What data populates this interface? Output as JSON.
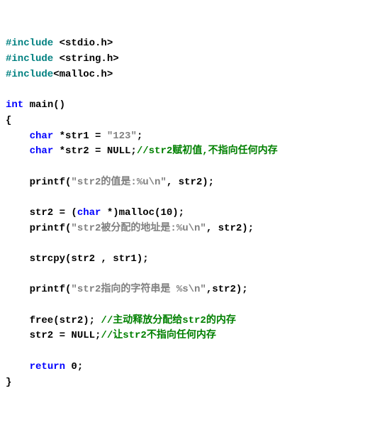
{
  "code": {
    "inc1_a": "#include",
    "inc1_b": " <stdio.h>",
    "inc2_a": "#include",
    "inc2_b": " <string.h>",
    "inc3_a": "#include",
    "inc3_b": "<malloc.h>",
    "int": "int",
    "main": " main()",
    "lbrace": "{",
    "char1_kw": "char",
    "char1_rest": " *str1 = ",
    "char1_str": "\"123\"",
    "char1_semi": ";",
    "char2_kw": "char",
    "char2_rest": " *str2 = NULL;",
    "char2_cmt": "//str2赋初值,不指向任何内存",
    "p1_a": "    printf(",
    "p1_str": "\"str2的值是:%u\\n\"",
    "p1_b": ", str2);",
    "malloc_a": "    str2 = (",
    "malloc_kw": "char",
    "malloc_b": " *)malloc(10);",
    "p2_a": "    printf(",
    "p2_str": "\"str2被分配的地址是:%u\\n\"",
    "p2_b": ", str2);",
    "strcpy": "    strcpy(str2 , str1);",
    "p3_a": "    printf(",
    "p3_str": "\"str2指向的字符串是 %s\\n\"",
    "p3_b": ",str2);",
    "free_a": "    free(str2); ",
    "free_cmt": "//主动释放分配给str2的内存",
    "null_a": "    str2 = NULL;",
    "null_cmt": "//让str2不指向任何内存",
    "ret_kw": "return",
    "ret_rest": " 0;",
    "rbrace": "}"
  }
}
